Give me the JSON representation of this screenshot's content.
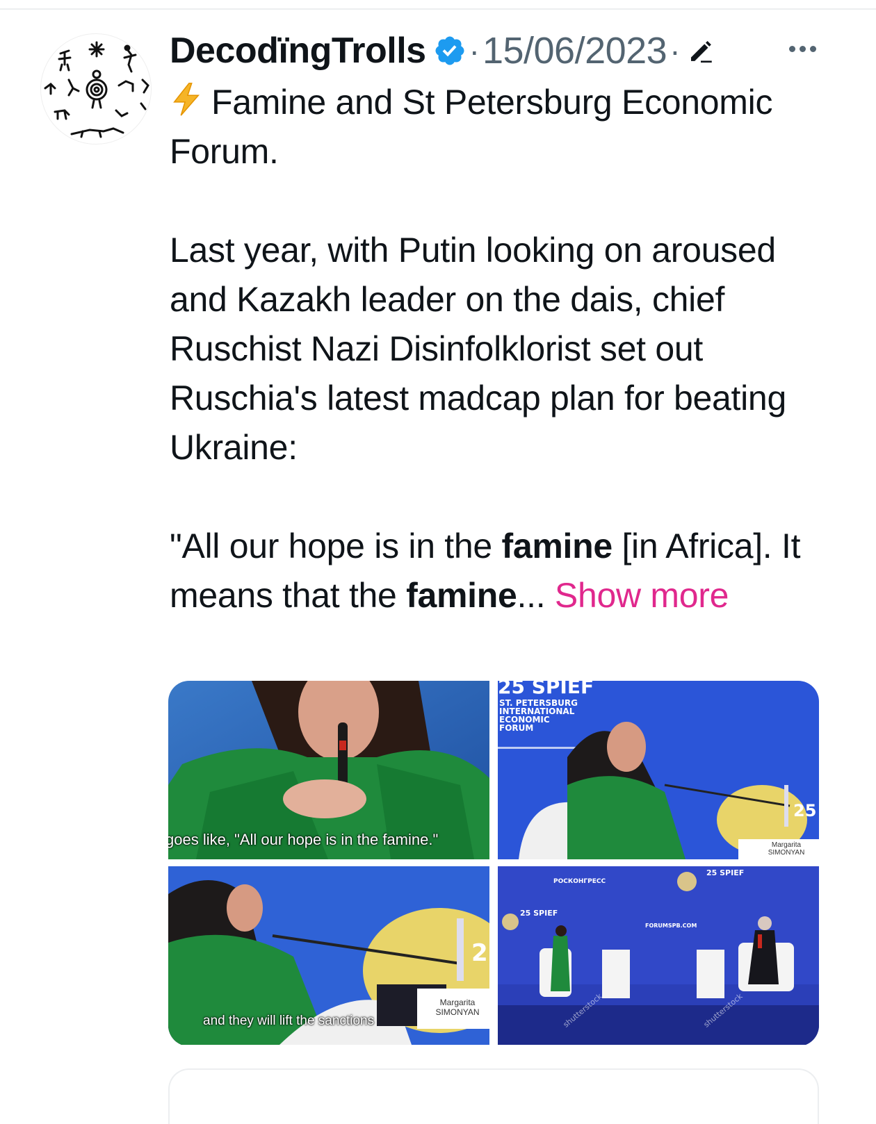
{
  "post": {
    "author": {
      "display_name": "DecodïngTrolls",
      "verified": true,
      "avatar_icon": "petroglyph-avatar-icon"
    },
    "separator": "·",
    "timestamp": "15/06/2023",
    "edit_icon": "pencil-icon",
    "more_icon": "more-dots-icon",
    "text": {
      "title": "Famine and St Petersburg Economic Forum.",
      "paragraph_1": "Last year, with Putin looking on aroused and Kazakh leader on the dais, chief Ruschist Nazi Disinfolklorist set out Ruschia's latest madcap plan for beating Ukraine:",
      "quote_open": "\"All our hope is in the ",
      "quote_bold_1": "famine",
      "quote_middle": " [in Africa]. It means that the ",
      "quote_bold_2": "famine",
      "quote_ellipsis": "...",
      "show_more": "Show more"
    },
    "media": [
      {
        "caption": "goes like, \"All our hope is in the famine.\""
      },
      {
        "logo": "25 SPIEF",
        "logo_sub": [
          "ST. PETERSBURG",
          "INTERNATIONAL",
          "ECONOMIC",
          "FORUM"
        ],
        "nameplate": [
          "Margarita",
          "SIMONYAN"
        ],
        "side_logo": "25"
      },
      {
        "caption": "and they will lift the sanctions",
        "nameplate": [
          "Margarita",
          "SIMONYAN"
        ],
        "side_logo": "2"
      },
      {
        "banner": "РОСКОНГРЕСС",
        "logo": "25 SPIEF",
        "website": "FORUMSPB.COM",
        "watermark": "shutterstock"
      }
    ]
  },
  "colors": {
    "text": "#0f1419",
    "secondary": "#536471",
    "verified": "#1d9bf0",
    "link": "#e0288d",
    "bolt": "#f5a623"
  }
}
